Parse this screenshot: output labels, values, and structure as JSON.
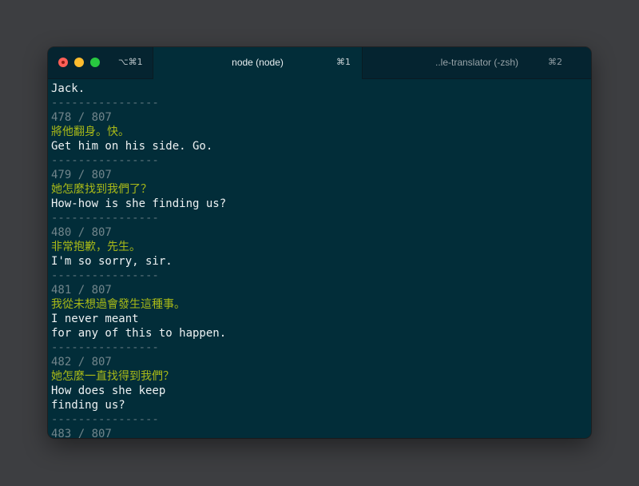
{
  "window": {
    "shortcut": "⌥⌘1",
    "tabs": [
      {
        "title": "node (node)",
        "shortcut": "⌘1"
      },
      {
        "title": "..le-translator (-zsh)",
        "shortcut": "⌘2"
      }
    ]
  },
  "terminal": {
    "lines": [
      {
        "type": "en",
        "text": "Jack."
      },
      {
        "type": "sep",
        "text": "----------------"
      },
      {
        "type": "count",
        "text": "478 / 807"
      },
      {
        "type": "zh",
        "text": "將他翻身。快。"
      },
      {
        "type": "en",
        "text": "Get him on his side. Go."
      },
      {
        "type": "sep",
        "text": "----------------"
      },
      {
        "type": "count",
        "text": "479 / 807"
      },
      {
        "type": "zh",
        "text": "她怎麼找到我們了？"
      },
      {
        "type": "en",
        "text": "How-how is she finding us?"
      },
      {
        "type": "sep",
        "text": "----------------"
      },
      {
        "type": "count",
        "text": "480 / 807"
      },
      {
        "type": "zh",
        "text": "非常抱歉，先生。"
      },
      {
        "type": "en",
        "text": "I'm so sorry, sir."
      },
      {
        "type": "sep",
        "text": "----------------"
      },
      {
        "type": "count",
        "text": "481 / 807"
      },
      {
        "type": "zh",
        "text": "我從未想過會發生這種事。"
      },
      {
        "type": "en",
        "text": "I never meant"
      },
      {
        "type": "en",
        "text": "for any of this to happen."
      },
      {
        "type": "sep",
        "text": "----------------"
      },
      {
        "type": "count",
        "text": "482 / 807"
      },
      {
        "type": "zh",
        "text": "她怎麼一直找得到我們？"
      },
      {
        "type": "en",
        "text": "How does she keep"
      },
      {
        "type": "en",
        "text": "finding us?"
      },
      {
        "type": "sep",
        "text": "----------------"
      },
      {
        "type": "count",
        "text": "483 / 807"
      }
    ]
  }
}
